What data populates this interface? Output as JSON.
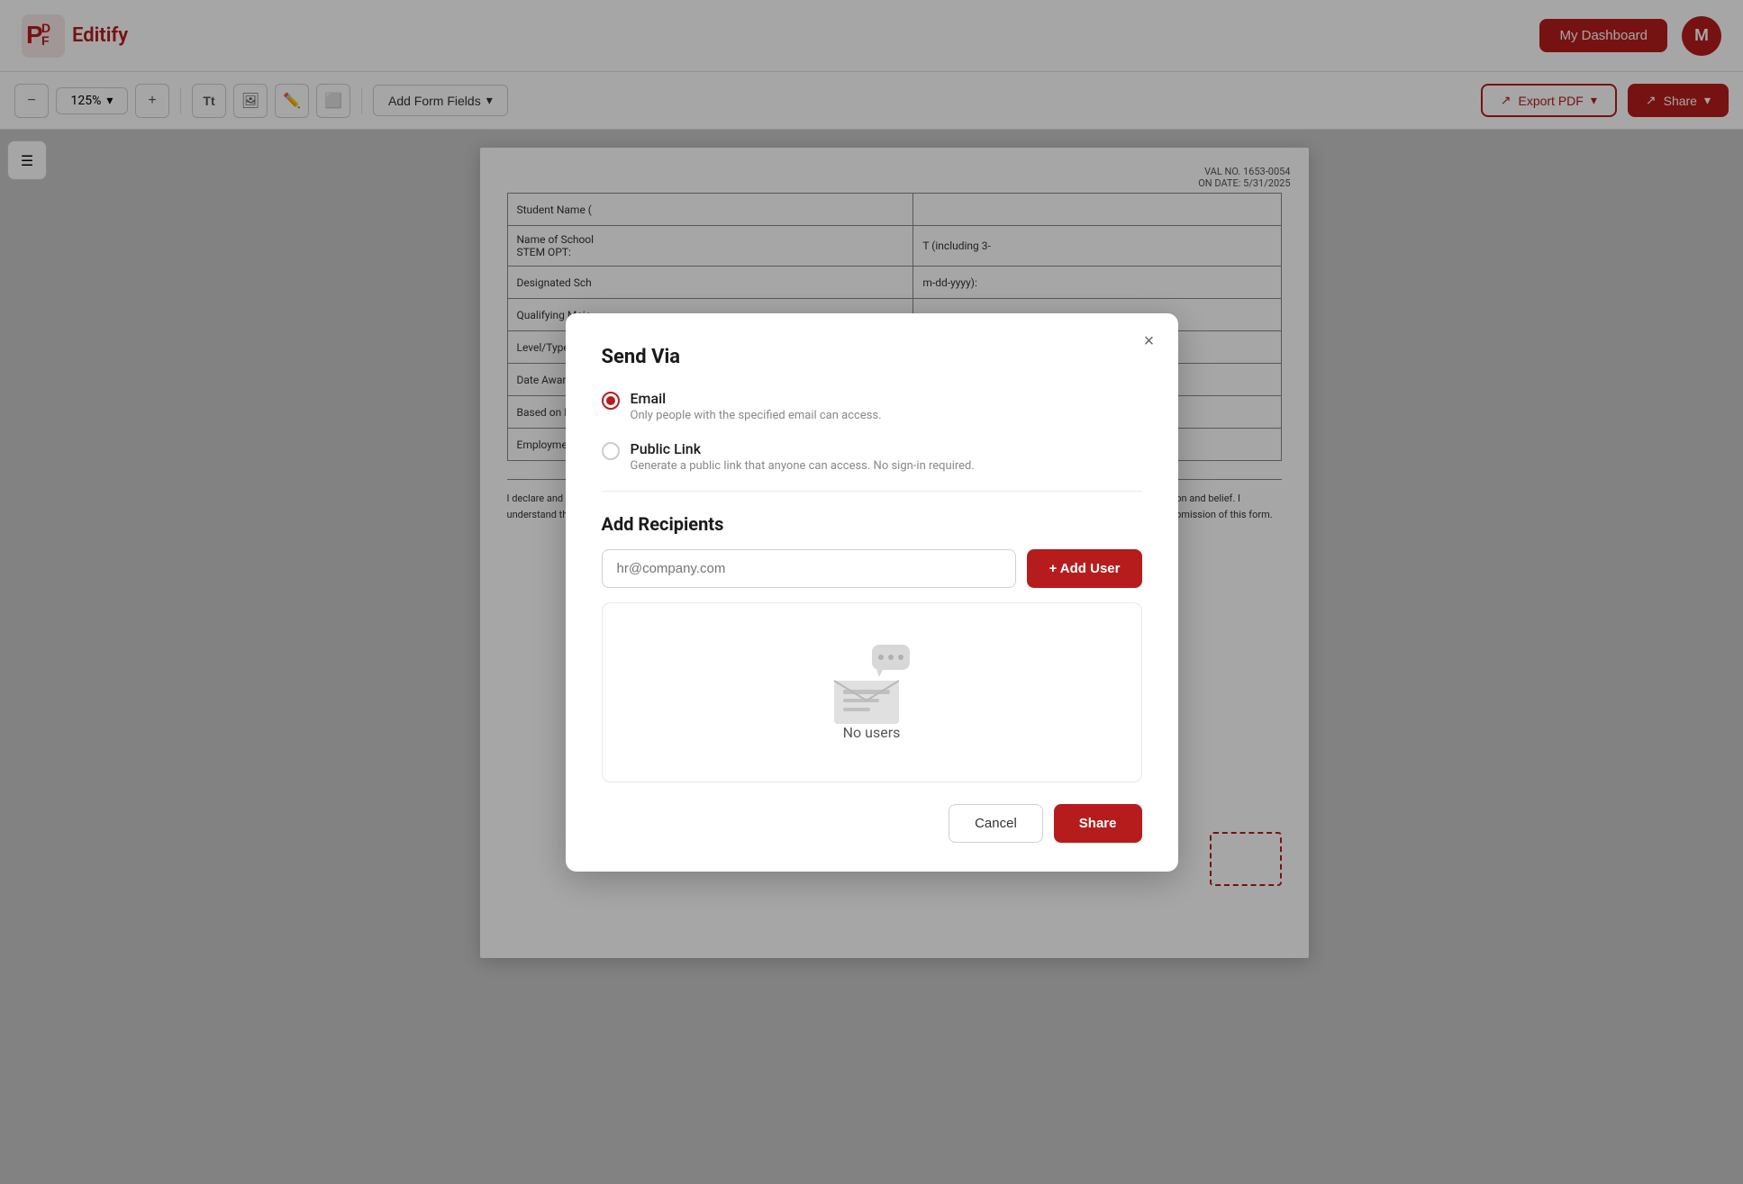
{
  "app": {
    "logo_letters": "PDF",
    "logo_name": "Editify",
    "dashboard_label": "My Dashboard",
    "avatar_letter": "M"
  },
  "toolbar": {
    "zoom_level": "125%",
    "zoom_arrow": "▾",
    "add_form_fields": "Add Form Fields",
    "add_form_arrow": "▾",
    "export_label": "Export PDF",
    "export_arrow": "▾",
    "share_label": "Share",
    "share_arrow": "▾"
  },
  "modal": {
    "title": "Send Via",
    "close_label": "×",
    "email_option": {
      "label": "Email",
      "description": "Only people with the specified email can access."
    },
    "public_link_option": {
      "label": "Public Link",
      "description": "Generate a public link that anyone can access. No sign-in required."
    },
    "add_recipients_title": "Add Recipients",
    "input_placeholder": "hr@company.com",
    "add_user_label": "+ Add User",
    "empty_state_text": "No users",
    "cancel_label": "Cancel",
    "share_label": "Share"
  },
  "document": {
    "corner_text1": "VAL NO. 1653-0054",
    "corner_text2": "ON DATE: 5/31/2025",
    "table_rows": [
      {
        "col1": "Student Name ("
      },
      {
        "col1": "Name of School",
        "col2": "T (including 3-"
      },
      {
        "col1": "STEM OPT:"
      },
      {
        "col1": "Designated Sch",
        "col2": "m-dd-yyyy):"
      },
      {
        "col1": "Qualifying Majo"
      },
      {
        "col1": "Level/Type of Q"
      },
      {
        "col1": "Date Awarded ("
      },
      {
        "col1": "Based on Prior"
      },
      {
        "col1": "Employment Au"
      }
    ],
    "footer_text": "I declare and affirm under penalty of perjury that the statements and information made herein are true and correct to the best of my knowledge, information and belief. I understand that the law provides severe penalties for knowingly and falsely falsifying or concealing a material fact, or using any false document in the submission of this form."
  }
}
